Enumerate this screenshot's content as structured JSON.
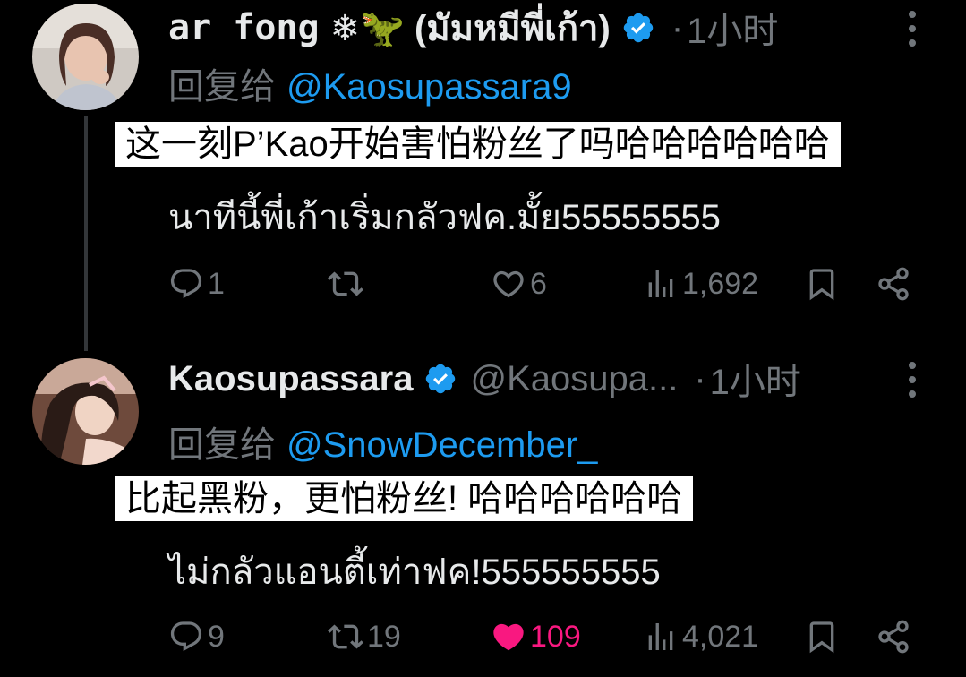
{
  "tweets": [
    {
      "display_name": "ar fong",
      "name_suffix": "❄🦖 (มัมหมีพี่เก้า)",
      "handle": "",
      "dot": "·",
      "time": "1小时",
      "reply_prefix": "回复给",
      "reply_to": "@Kaosupassara9",
      "translation": "这一刻P’Kao开始害怕粉丝了吗哈哈哈哈哈哈",
      "text": "นาทีนี้พี่เก้าเริ่มกลัวฟค.มั้ย55555555",
      "replies": "1",
      "retweets": "",
      "likes": "6",
      "views": "1,692",
      "liked": false
    },
    {
      "display_name": "Kaosupassara",
      "name_suffix": "",
      "handle": "@Kaosupa...",
      "dot": "·",
      "time": "1小时",
      "reply_prefix": "回复给",
      "reply_to": "@SnowDecember_",
      "translation": "比起黑粉，更怕粉丝! 哈哈哈哈哈哈",
      "text": "ไม่กลัวแอนตี้เท่าฟค!555555555",
      "replies": "9",
      "retweets": "19",
      "likes": "109",
      "views": "4,021",
      "liked": true
    }
  ],
  "colors": {
    "background": "#000000",
    "text": "#e7e9ea",
    "muted": "#71767b",
    "accent": "#1d9bf0",
    "like_active": "#f91880"
  },
  "icons": [
    "verified-badge-icon",
    "more-icon",
    "reply-icon",
    "retweet-icon",
    "like-icon",
    "views-icon",
    "bookmark-icon",
    "share-icon"
  ]
}
